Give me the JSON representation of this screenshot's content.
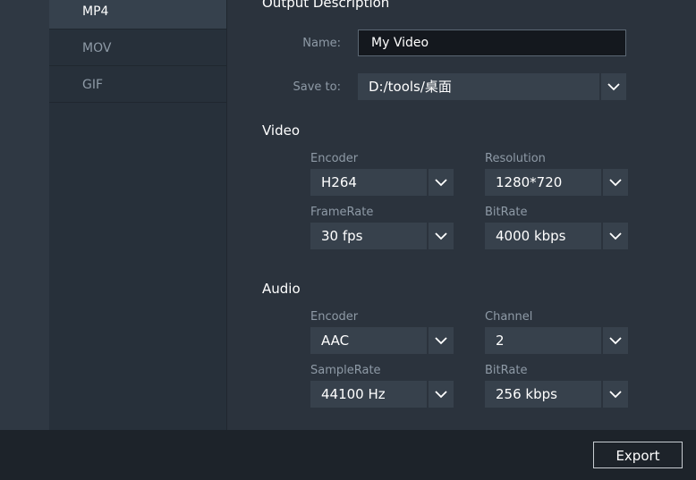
{
  "formats": [
    {
      "label": "MP4",
      "selected": true
    },
    {
      "label": "MOV",
      "selected": false
    },
    {
      "label": "GIF",
      "selected": false
    }
  ],
  "output": {
    "title": "Output Description",
    "name_label": "Name:",
    "name_value": "My Video",
    "save_label": "Save to:",
    "save_value": "D:/tools/桌面"
  },
  "video": {
    "title": "Video",
    "encoder_label": "Encoder",
    "encoder_value": "H264",
    "resolution_label": "Resolution",
    "resolution_value": "1280*720",
    "framerate_label": "FrameRate",
    "framerate_value": "30 fps",
    "bitrate_label": "BitRate",
    "bitrate_value": "4000 kbps"
  },
  "audio": {
    "title": "Audio",
    "encoder_label": "Encoder",
    "encoder_value": "AAC",
    "channel_label": "Channel",
    "channel_value": "2",
    "samplerate_label": "SampleRate",
    "samplerate_value": "44100 Hz",
    "bitrate_label": "BitRate",
    "bitrate_value": "256 kbps"
  },
  "footer": {
    "export_label": "Export"
  },
  "colors": {
    "background": "#2b333d",
    "sidebar": "#27303a",
    "selected": "#36414d",
    "field": "#37414c",
    "footer": "#1d232a",
    "label": "#8e9aa6"
  },
  "icons": {
    "dropdown": "chevron-down-icon"
  }
}
